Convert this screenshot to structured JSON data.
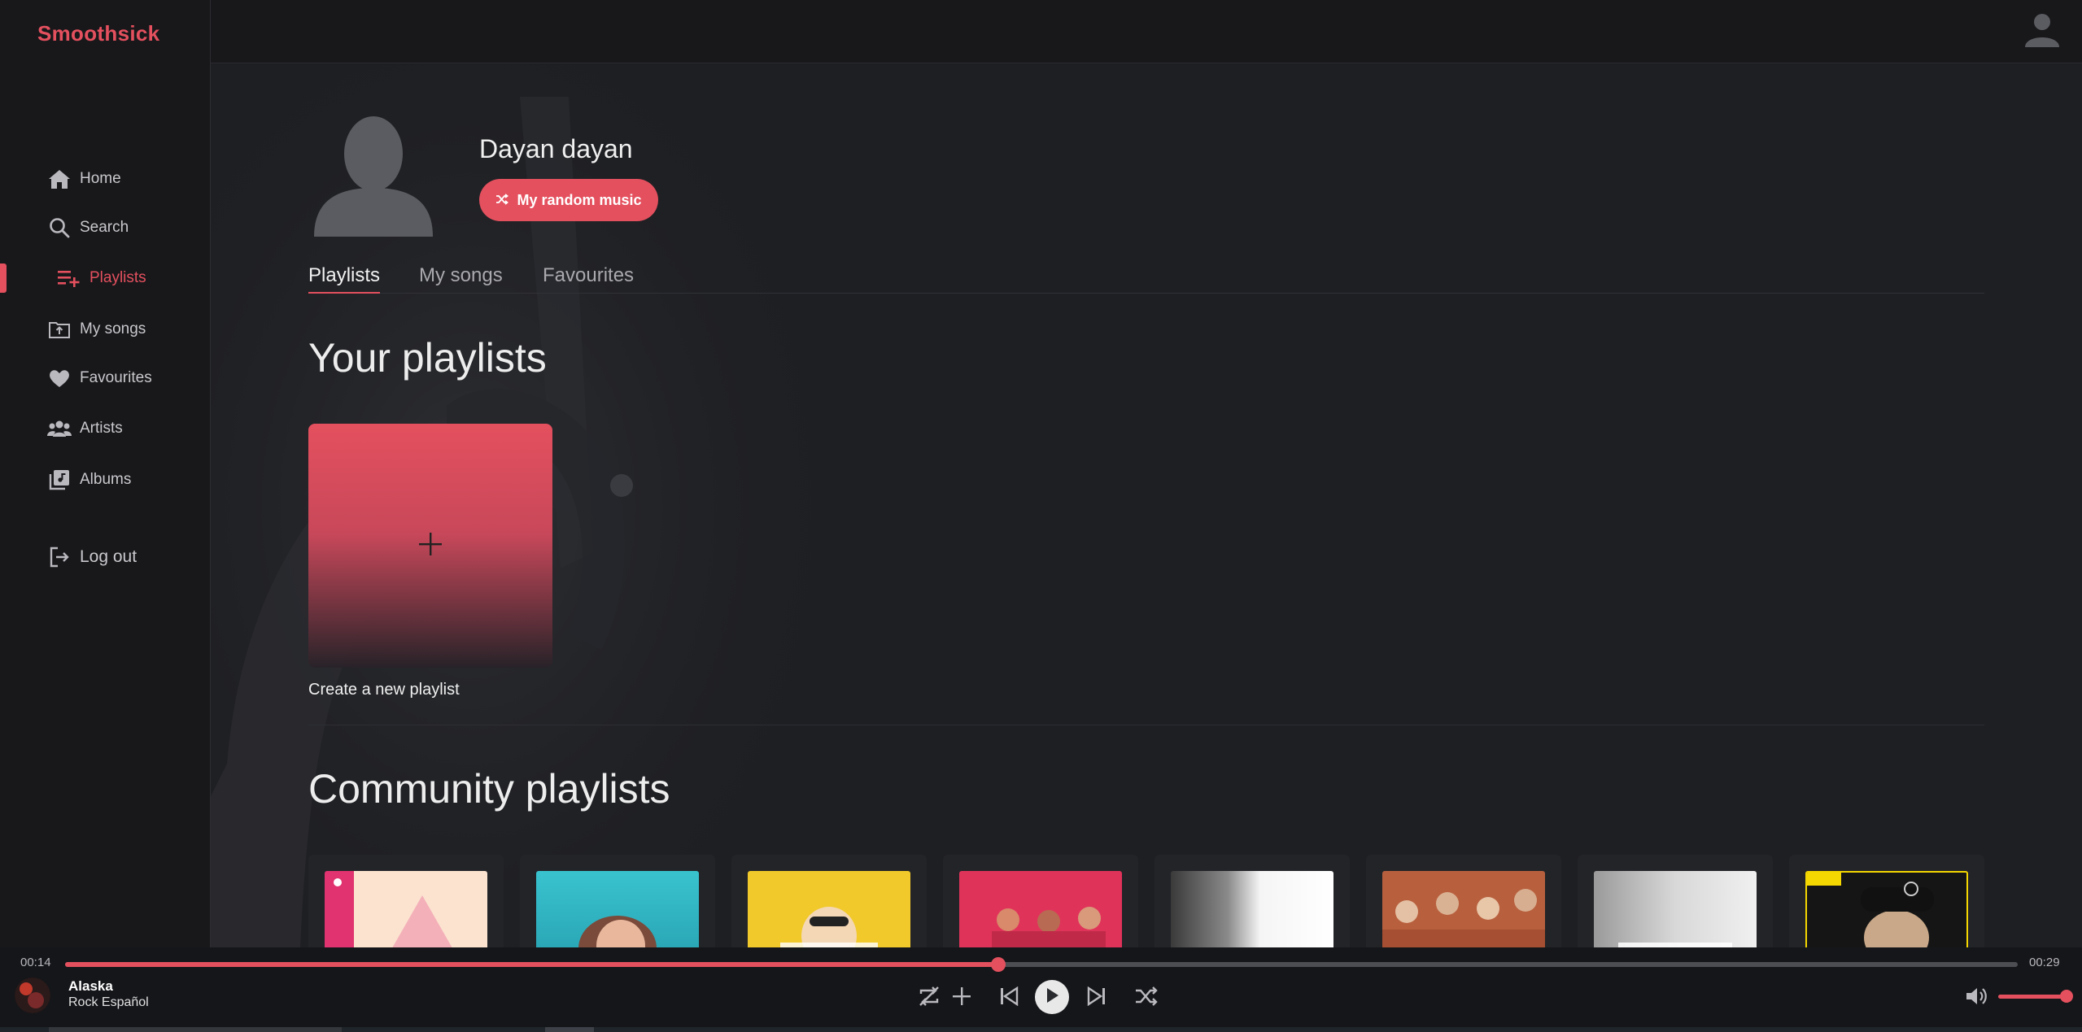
{
  "app": {
    "name": "Smoothsick"
  },
  "sidebar": {
    "items": [
      {
        "label": "Home",
        "icon": "home-icon"
      },
      {
        "label": "Search",
        "icon": "search-icon"
      },
      {
        "label": "Playlists",
        "icon": "playlist-add-icon",
        "active": true
      },
      {
        "label": "My songs",
        "icon": "upload-folder-icon"
      },
      {
        "label": "Favourites",
        "icon": "heart-icon"
      },
      {
        "label": "Artists",
        "icon": "people-icon"
      },
      {
        "label": "Albums",
        "icon": "album-library-icon"
      }
    ],
    "logout": {
      "label": "Log out",
      "icon": "logout-icon"
    }
  },
  "profile": {
    "name": "Dayan dayan",
    "random_button": "My random music"
  },
  "tabs": [
    {
      "label": "Playlists",
      "active": true
    },
    {
      "label": "My songs"
    },
    {
      "label": "Favourites"
    }
  ],
  "your_playlists": {
    "heading": "Your playlists",
    "create_label": "Create a new playlist"
  },
  "community_playlists": {
    "heading": "Community playlists",
    "cards": 8
  },
  "player": {
    "elapsed": "00:14",
    "duration": "00:29",
    "progress": 0.478,
    "volume": 0.95,
    "track_title": "Alaska",
    "track_artist": "Rock Español"
  },
  "colors": {
    "accent": "#e4505e",
    "background": "#1e1f23",
    "sidebar": "#18181b"
  }
}
